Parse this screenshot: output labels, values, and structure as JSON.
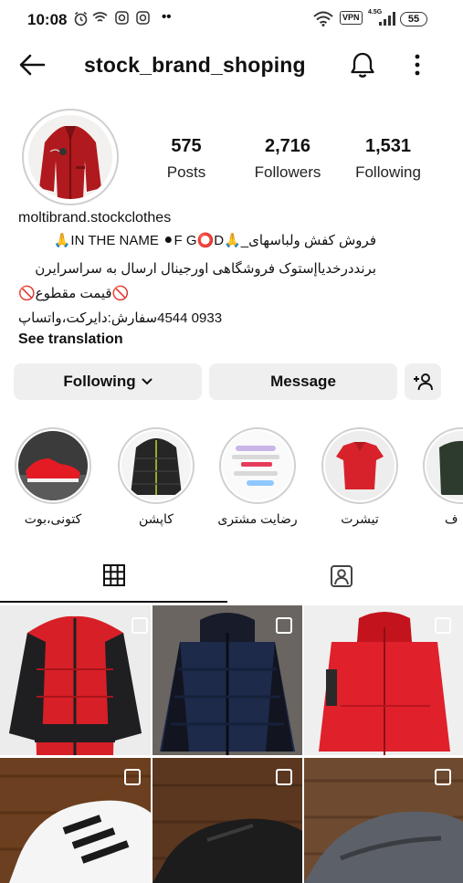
{
  "status_bar": {
    "time": "10:08",
    "network": "4.5G",
    "battery": "55",
    "vpn": "VPN",
    "notification_dots": "••"
  },
  "header": {
    "username": "stock_brand_shoping"
  },
  "profile": {
    "stats": [
      {
        "value": "575",
        "label": "Posts"
      },
      {
        "value": "2,716",
        "label": "Followers"
      },
      {
        "value": "1,531",
        "label": "Following"
      }
    ],
    "name": "moltibrand.stockclothes",
    "bio_lines": [
      "فروش کفش ولباسهای_🙏IN THE NAME ⚫F G⭕D🙏",
      "برنددرخدیاإستوک فروشگاهی اورجینال ارسال به سراسرایرن",
      "🚫قیمت مقطوع🚫",
      "0933      4544سفارش:دایرکت،واتساپ"
    ],
    "see_translation": "See translation"
  },
  "actions": {
    "following_label": "Following",
    "message_label": "Message"
  },
  "highlights": [
    {
      "label": "کتونی،بوت"
    },
    {
      "label": "کاپشن"
    },
    {
      "label": "رضایت مشتری"
    },
    {
      "label": "تیشرت"
    },
    {
      "label": "ف"
    }
  ],
  "tabs": {
    "active": "grid"
  },
  "colors": {
    "accent_red": "#d8222b",
    "button_bg": "#efefef",
    "tab_indicator": "#111111"
  }
}
